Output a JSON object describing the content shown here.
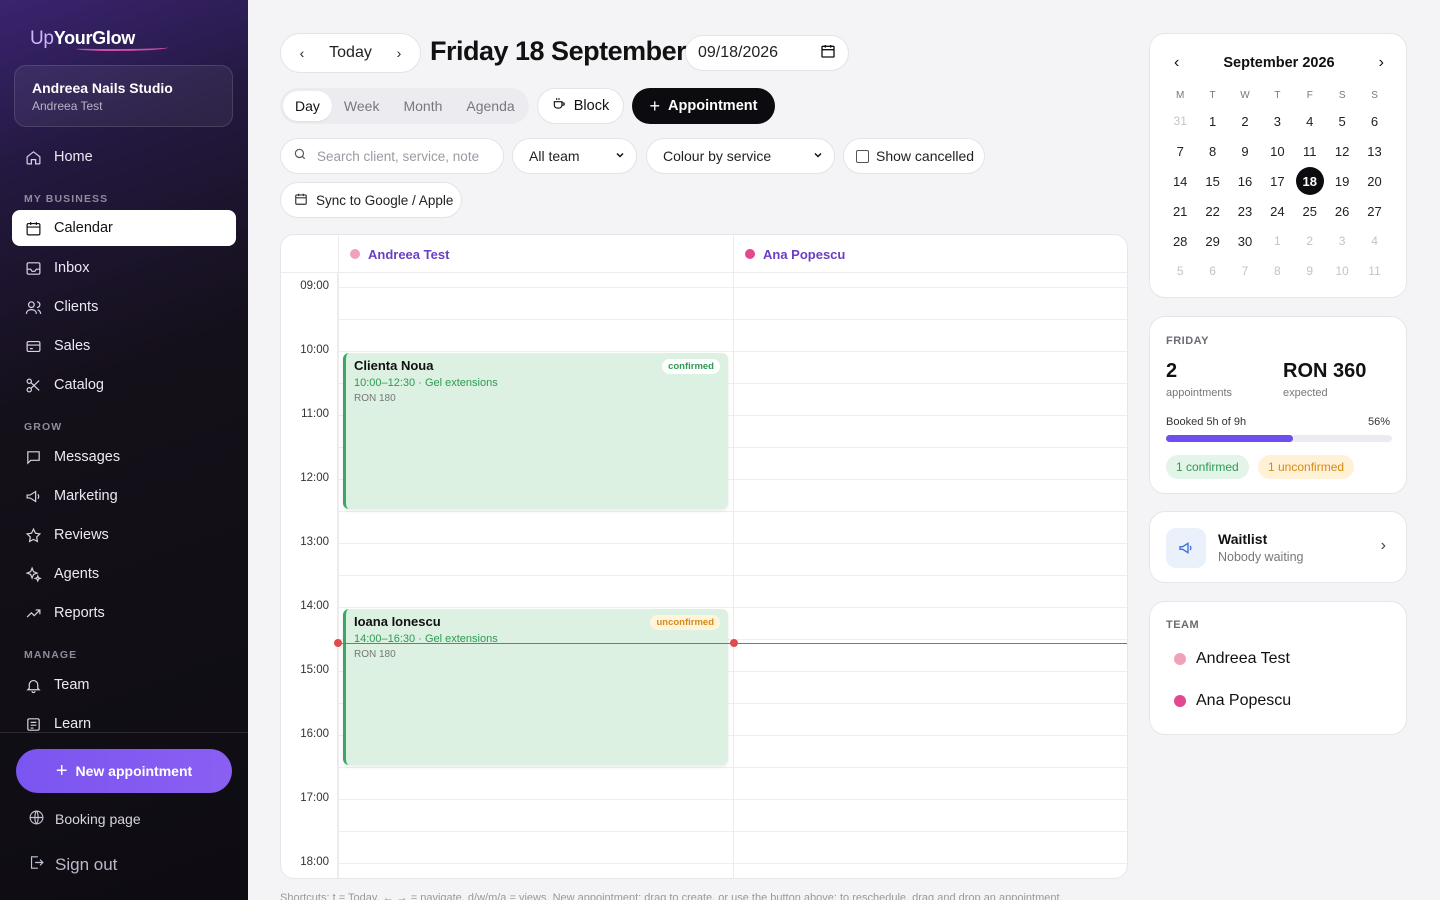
{
  "brand": {
    "prefix": "Up",
    "name": "YourGlow"
  },
  "studio": {
    "name": "Andreea Nails Studio",
    "user": "Andreea Test"
  },
  "sidebar": {
    "items": [
      {
        "label": "Home",
        "icon": "home-icon"
      },
      {
        "label": "Calendar",
        "icon": "calendar-icon",
        "active": true
      },
      {
        "label": "Inbox",
        "icon": "inbox-icon"
      },
      {
        "label": "Clients",
        "icon": "users-icon"
      },
      {
        "label": "Sales",
        "icon": "card-icon"
      },
      {
        "label": "Catalog",
        "icon": "scissors-icon"
      },
      {
        "label": "Messages",
        "icon": "message-icon"
      },
      {
        "label": "Marketing",
        "icon": "megaphone-icon"
      },
      {
        "label": "Reviews",
        "icon": "star-icon"
      },
      {
        "label": "Agents",
        "icon": "sparkles-icon"
      },
      {
        "label": "Reports",
        "icon": "trend-icon"
      },
      {
        "label": "Team",
        "icon": "bell-icon"
      },
      {
        "label": "Learn",
        "icon": "book-icon"
      }
    ],
    "sections": {
      "business": "MY BUSINESS",
      "grow": "GROW",
      "manage": "MANAGE"
    },
    "new_appointment": "New appointment",
    "booking_page": "Booking page",
    "sign_out": "Sign out"
  },
  "header": {
    "today": "Today",
    "title": "Friday 18 September",
    "date_value": "09/18/2026",
    "views": [
      "Day",
      "Week",
      "Month",
      "Agenda"
    ],
    "active_view": "Day",
    "block": "Block",
    "appointment": "Appointment"
  },
  "filters": {
    "search_placeholder": "Search client, service, note",
    "team_select": "All team",
    "colour_select": "Colour by service",
    "show_cancelled": "Show cancelled",
    "sync": "Sync to Google / Apple"
  },
  "calendar": {
    "staff": [
      {
        "name": "Andreea Test",
        "color": "#f0a3b8",
        "label_color": "#6a3fc4"
      },
      {
        "name": "Ana Popescu",
        "color": "#e2478f",
        "label_color": "#6a3fc4"
      }
    ],
    "hours": [
      "09:00",
      "10:00",
      "11:00",
      "12:00",
      "13:00",
      "14:00",
      "15:00",
      "16:00",
      "17:00",
      "18:00"
    ],
    "events": [
      {
        "client": "Clienta Noua",
        "details": "10:00–12:30 · Gel extensions",
        "price": "RON 180",
        "status": "confirmed"
      },
      {
        "client": "Ioana Ionescu",
        "details": "14:00–16:30 · Gel extensions",
        "price": "RON 180",
        "status": "unconfirmed"
      }
    ]
  },
  "footnote": "Shortcuts: t = Today, ← → = navigate, d/w/m/a = views. New appointment: drag to create, or use the button above; to reschedule, drag and drop an appointment.",
  "mini_calendar": {
    "month": "September 2026",
    "dow": [
      "M",
      "T",
      "W",
      "T",
      "F",
      "S",
      "S"
    ],
    "weeks": [
      [
        "31",
        "1",
        "2",
        "3",
        "4",
        "5",
        "6"
      ],
      [
        "7",
        "8",
        "9",
        "10",
        "11",
        "12",
        "13"
      ],
      [
        "14",
        "15",
        "16",
        "17",
        "18",
        "19",
        "20"
      ],
      [
        "21",
        "22",
        "23",
        "24",
        "25",
        "26",
        "27"
      ],
      [
        "28",
        "29",
        "30",
        "1",
        "2",
        "3",
        "4"
      ],
      [
        "5",
        "6",
        "7",
        "8",
        "9",
        "10",
        "11"
      ]
    ],
    "selected": "18"
  },
  "summary": {
    "day": "FRIDAY",
    "appointments_count": "2",
    "appointments_label": "appointments",
    "expected_value": "RON 360",
    "expected_label": "expected",
    "booked_text": "Booked 5h of 9h",
    "booked_percent": "56%",
    "booked_fraction": 0.56,
    "confirmed_tag": "1 confirmed",
    "unconfirmed_tag": "1 unconfirmed"
  },
  "waitlist": {
    "title": "Waitlist",
    "subtitle": "Nobody waiting"
  },
  "team": {
    "heading": "TEAM",
    "members": [
      {
        "name": "Andreea Test",
        "color": "#f0a3b8"
      },
      {
        "name": "Ana Popescu",
        "color": "#e2478f"
      }
    ]
  },
  "colors": {
    "accent": "#7b55f0",
    "confirmed": "#2f9a53",
    "unconfirmed": "#d98a12",
    "now_line": "#e24b4b"
  }
}
